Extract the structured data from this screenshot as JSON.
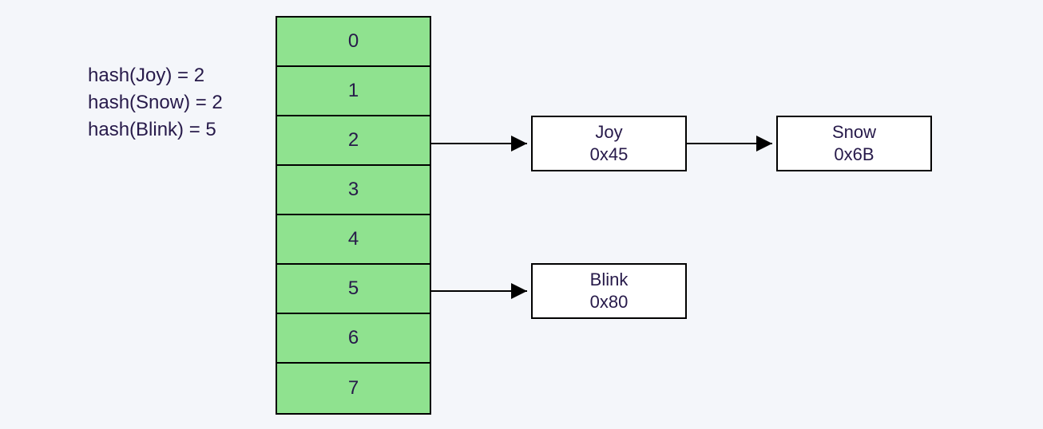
{
  "hash_equations": [
    "hash(Joy) = 2",
    "hash(Snow) = 2",
    "hash(Blink) = 5"
  ],
  "buckets": [
    "0",
    "1",
    "2",
    "3",
    "4",
    "5",
    "6",
    "7"
  ],
  "nodes": {
    "joy": {
      "name": "Joy",
      "addr": "0x45"
    },
    "snow": {
      "name": "Snow",
      "addr": "0x6B"
    },
    "blink": {
      "name": "Blink",
      "addr": "0x80"
    }
  }
}
